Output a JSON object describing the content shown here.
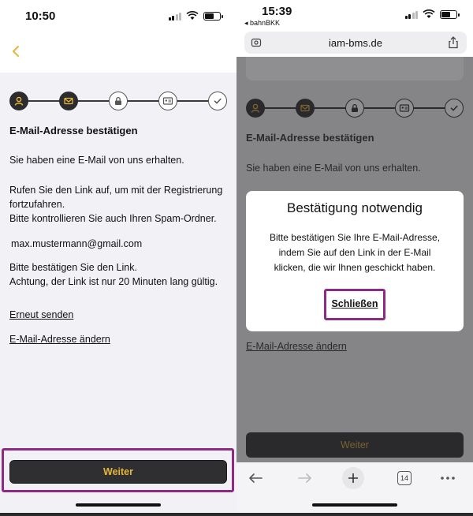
{
  "left": {
    "status_time": "10:50",
    "title": "E-Mail-Adresse bestätigen",
    "intro": "Sie haben eine E-Mail von uns erhalten.",
    "instr_line1": "Rufen Sie den Link auf, um mit der Registrierung",
    "instr_line2": "fortzufahren.",
    "instr_line3": "Bitte kontrollieren Sie auch Ihren Spam-Ordner.",
    "email": "max.mustermann@gmail.com",
    "confirm_line1": "Bitte bestätigen Sie den Link.",
    "confirm_line2": "Achtung, der Link ist nur 20 Minuten lang gültig.",
    "resend_link": "Erneut senden",
    "change_email_link": "E-Mail-Adresse ändern",
    "continue_button": "Weiter"
  },
  "right": {
    "status_time": "15:39",
    "back_to_app": "◂ bahnBKK",
    "url": "iam-bms.de",
    "title": "E-Mail-Adresse bestätigen",
    "intro": "Sie haben eine E-Mail von uns erhalten.",
    "change_email_link": "E-Mail-Adresse ändern",
    "continue_button": "Weiter",
    "tab_count": "14",
    "dialog": {
      "title": "Bestätigung notwendig",
      "msg_line1": "Bitte bestätigen Sie Ihre E-Mail-Adresse,",
      "msg_line2": "indem Sie auf den Link in der E-Mail",
      "msg_line3": "klicken, die wir Ihnen geschickt haben.",
      "close": "Schließen"
    }
  },
  "stepper": {
    "steps": [
      "person-icon",
      "envelope-icon",
      "lock-icon",
      "id-card-icon",
      "checkmark-icon"
    ],
    "current_step": 2
  },
  "colors": {
    "accent": "#e5b637",
    "highlight": "#8d2a86",
    "dark_button": "#2f2f31",
    "background": "#f2f1f6"
  }
}
